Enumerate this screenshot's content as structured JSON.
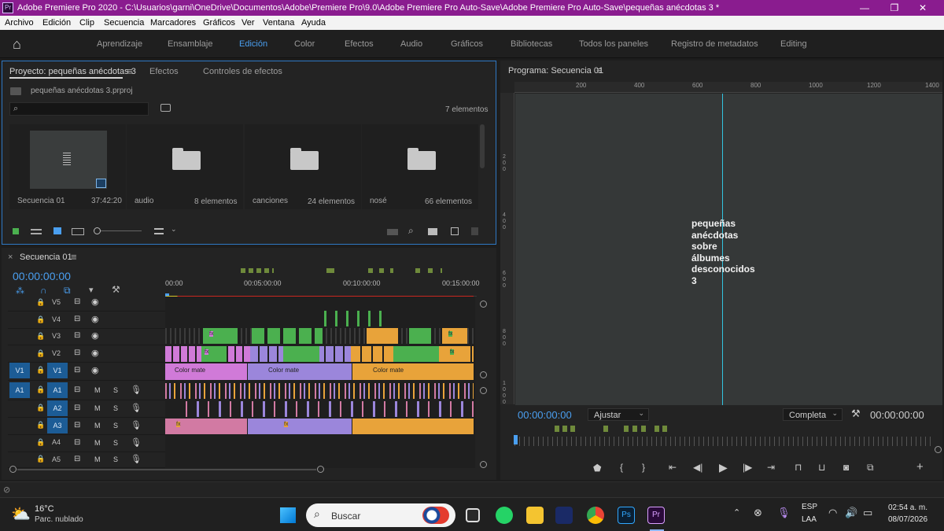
{
  "titlebar": {
    "title": "Adobe Premiere Pro 2020 - C:\\Usuarios\\garni\\OneDrive\\Documentos\\Adobe\\Premiere Pro\\9.0\\Adobe Premiere Pro Auto-Save\\Adobe Premiere Pro Auto-Save\\pequeñas anécdotas 3 *",
    "app_badge": "Pr",
    "minimize": "—",
    "maximize": "❐",
    "close": "✕"
  },
  "menubar": [
    "Archivo",
    "Edición",
    "Clip",
    "Secuencia",
    "Marcadores",
    "Gráficos",
    "Ver",
    "Ventana",
    "Ayuda"
  ],
  "workspaces": {
    "home": "⌂",
    "items": [
      "Aprendizaje",
      "Ensamblaje",
      "Edición",
      "Color",
      "Efectos",
      "Audio",
      "Gráficos",
      "Bibliotecas",
      "Todos los paneles",
      "Registro de metadatos",
      "Editing"
    ],
    "active": "Edición"
  },
  "project_panel": {
    "tabs": [
      "Proyecto: pequeñas anécdotas 3",
      "Efectos",
      "Controles de efectos"
    ],
    "menu_icon": "≡",
    "file_name": "pequeñas anécdotas 3.prproj",
    "search_placeholder": "",
    "item_count": "7 elementos",
    "items": [
      {
        "name": "Secuencia 01",
        "meta": "37:42:20",
        "type": "sequence"
      },
      {
        "name": "audio",
        "meta": "8 elementos",
        "type": "folder"
      },
      {
        "name": "canciones",
        "meta": "24 elementos",
        "type": "folder"
      },
      {
        "name": "nosé",
        "meta": "66 elementos",
        "type": "folder"
      }
    ]
  },
  "timeline": {
    "tab": "Secuencia 01",
    "timecode": "00:00:00:00",
    "ruler": [
      "00:00",
      "00:05:00:00",
      "00:10:00:00",
      "00:15:00:00"
    ],
    "video_tracks": [
      "V5",
      "V4",
      "V3",
      "V2",
      "V1"
    ],
    "audio_tracks": [
      "A1",
      "A2",
      "A3",
      "A4",
      "A5"
    ],
    "source_v": "V1",
    "source_a": "A1",
    "mute": "M",
    "solo": "S",
    "color_mate_label": "Color mate",
    "fx_label": "fx"
  },
  "program_monitor": {
    "title": "Programa: Secuencia 01",
    "ruler": [
      "200",
      "400",
      "600",
      "800",
      "1000",
      "1200",
      "1400"
    ],
    "vruler": [
      "2",
      "0",
      "0",
      "4",
      "0",
      "0",
      "6",
      "0",
      "0",
      "8",
      "0",
      "0",
      "1",
      "0",
      "0",
      "0"
    ],
    "overlay_text": [
      "pequeñas",
      "anécdotas",
      "sobre",
      "álbumes",
      "desconocidos",
      "3"
    ],
    "timecode_left": "00:00:00:00",
    "fit": "Ajustar",
    "quality": "Completa",
    "timecode_right": "00:00:00:00"
  },
  "taskbar": {
    "weather_temp": "16°C",
    "weather_desc": "Parc. nublado",
    "search": "Buscar",
    "lang": "ESP",
    "lang2": "LAA",
    "time": "02:54 a. m.",
    "date": "08/07/2026"
  },
  "colors": {
    "accent": "#4a9ff0",
    "title": "#8a1c8f",
    "clip_green": "#4bb04f",
    "clip_pink": "#d07ad8",
    "clip_lilac": "#9b86db",
    "clip_orange": "#e8a33a",
    "audio_pink": "#d27aa3",
    "cyan": "#33c4e0"
  }
}
